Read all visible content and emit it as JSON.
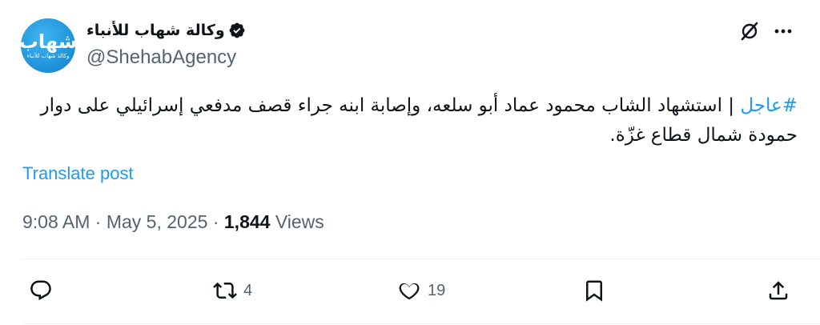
{
  "author": {
    "display_name": "وكالة شهاب للأنباء",
    "handle": "@ShehabAgency",
    "avatar_text": "شهاب",
    "avatar_subtext": "وكالة شهاب للأنباء",
    "verified": true
  },
  "tweet": {
    "hashtag": "#عاجل",
    "text": " | استشهاد الشاب محمود عماد أبو سلعه، وإصابة ابنه جراء قصف مدفعي إسرائيلي على دوار حمودة شمال قطاع غزّة."
  },
  "translate_label": "Translate post",
  "meta": {
    "time": "9:08 AM",
    "separator": "·",
    "date": "May 5, 2025",
    "views_count": "1,844",
    "views_label": "Views"
  },
  "actions": {
    "reply_count": "",
    "retweet_count": "4",
    "like_count": "19"
  },
  "icons": {
    "grok": "grok-icon",
    "more": "more-icon",
    "reply": "reply-icon",
    "retweet": "retweet-icon",
    "like": "heart-icon",
    "bookmark": "bookmark-icon",
    "share": "share-icon"
  },
  "colors": {
    "accent": "#1d9bf0",
    "text": "#0f1419",
    "secondary": "#536471"
  }
}
